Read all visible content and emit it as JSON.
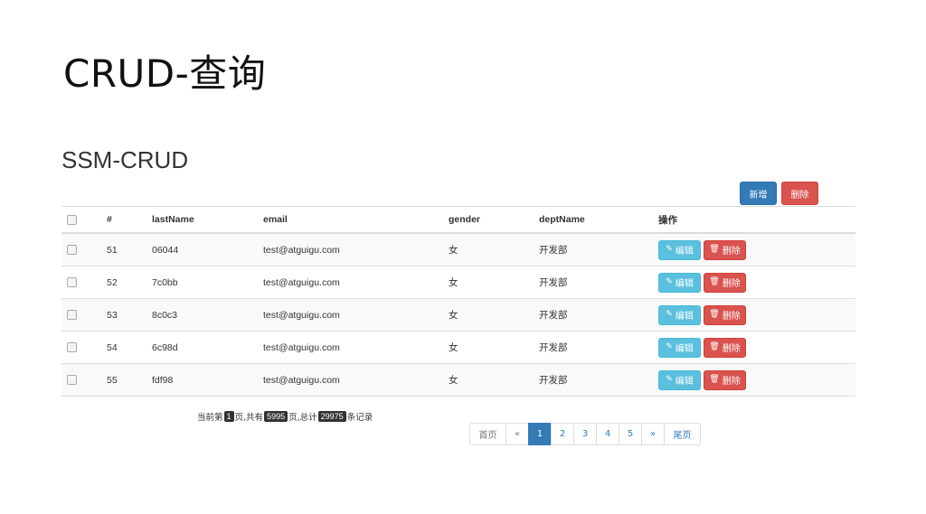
{
  "slide": {
    "title": "CRUD-查询"
  },
  "app": {
    "title": "SSM-CRUD"
  },
  "toolbar": {
    "add_label": "新增",
    "delete_label": "删除"
  },
  "table": {
    "headers": [
      "#",
      "lastName",
      "email",
      "gender",
      "deptName",
      "操作"
    ],
    "rows": [
      {
        "id": "51",
        "lastName": "06044",
        "email": "test@atguigu.com",
        "gender": "女",
        "deptName": "开发部"
      },
      {
        "id": "52",
        "lastName": "7c0bb",
        "email": "test@atguigu.com",
        "gender": "女",
        "deptName": "开发部"
      },
      {
        "id": "53",
        "lastName": "8c0c3",
        "email": "test@atguigu.com",
        "gender": "女",
        "deptName": "开发部"
      },
      {
        "id": "54",
        "lastName": "6c98d",
        "email": "test@atguigu.com",
        "gender": "女",
        "deptName": "开发部"
      },
      {
        "id": "55",
        "lastName": "fdf98",
        "email": "test@atguigu.com",
        "gender": "女",
        "deptName": "开发部"
      }
    ],
    "row_actions": {
      "edit_label": "编辑",
      "delete_label": "删除"
    }
  },
  "page_info": {
    "prefix": "当前第",
    "current": "1",
    "mid1": "页,共有",
    "total_pages": "5995",
    "mid2": "页,总计",
    "total_records": "29975",
    "suffix": "条记录"
  },
  "pagination": {
    "first": "首页",
    "prev": "«",
    "pages": [
      "1",
      "2",
      "3",
      "4",
      "5"
    ],
    "active_page": "1",
    "next": "»",
    "last": "尾页"
  },
  "colors": {
    "primary": "#337ab7",
    "danger": "#d9534f",
    "info": "#5bc0de"
  }
}
